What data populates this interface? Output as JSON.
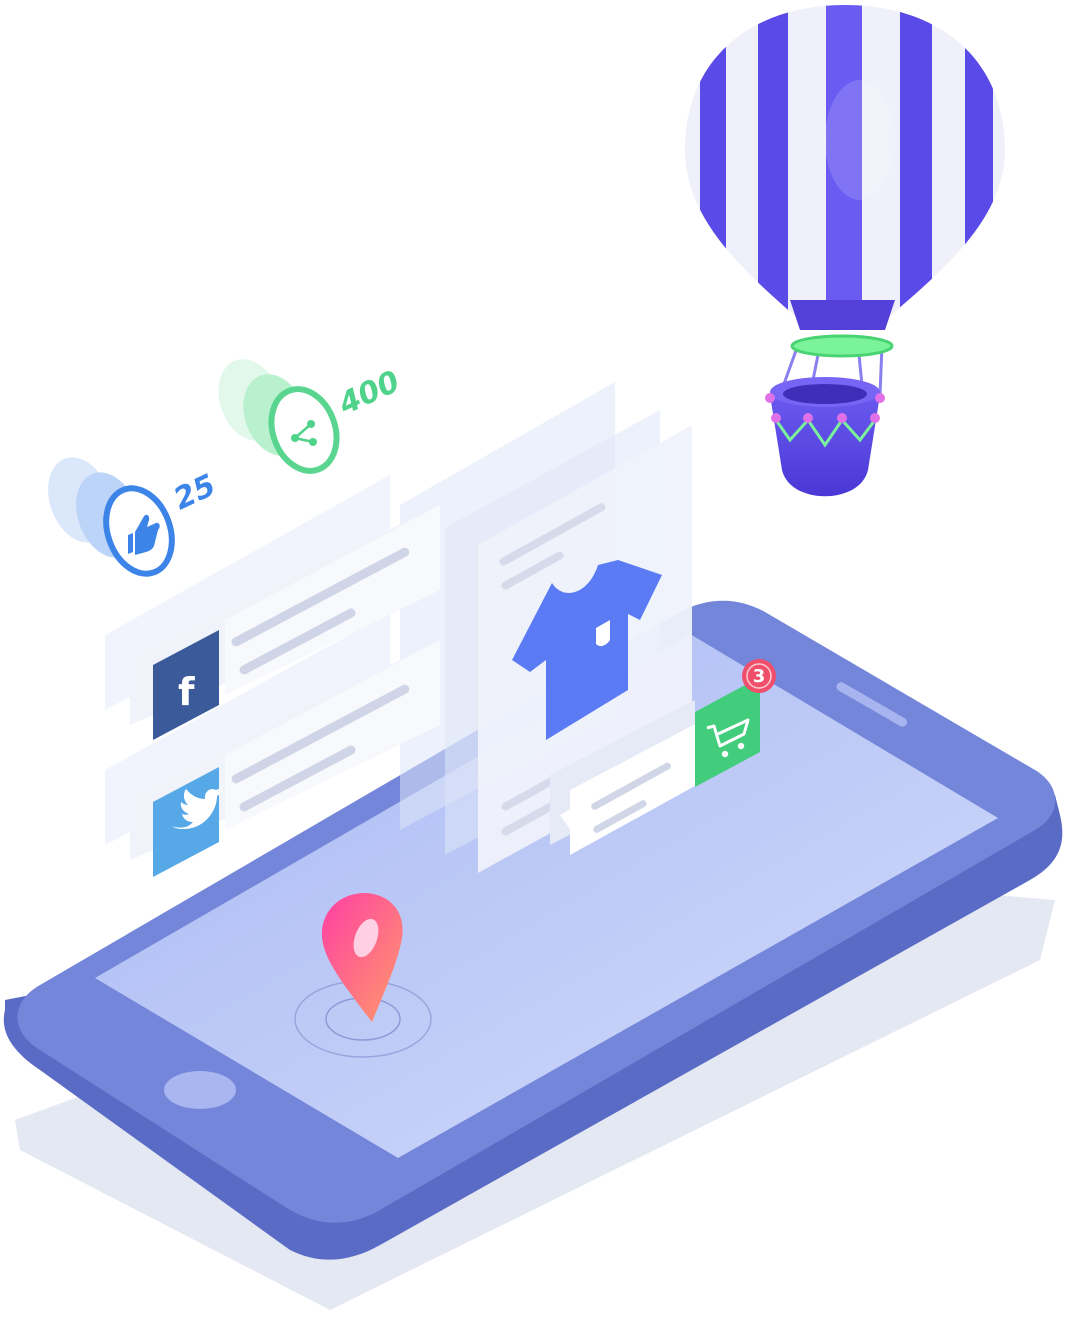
{
  "social": {
    "likes_count": "25",
    "shares_count": "400"
  },
  "cart": {
    "badge_count": "3"
  },
  "icons": {
    "like": "thumbs-up-icon",
    "share": "share-icon",
    "facebook": "facebook-icon",
    "twitter": "twitter-icon",
    "product": "tshirt-icon",
    "cart": "shopping-cart-icon",
    "location": "location-pin-icon"
  },
  "colors": {
    "phone_body": "#6c7fd6",
    "phone_screen": "#b9c8f7",
    "like_blue": "#3d84e8",
    "share_green": "#4fd38a",
    "facebook": "#3b5a99",
    "twitter": "#56a9e6",
    "tshirt": "#5b7bf5",
    "cart_green": "#41cd7b",
    "badge_red": "#ef4f6a",
    "balloon_purple": "#5a4ae8",
    "pin_pink": "#ff4f9a"
  }
}
